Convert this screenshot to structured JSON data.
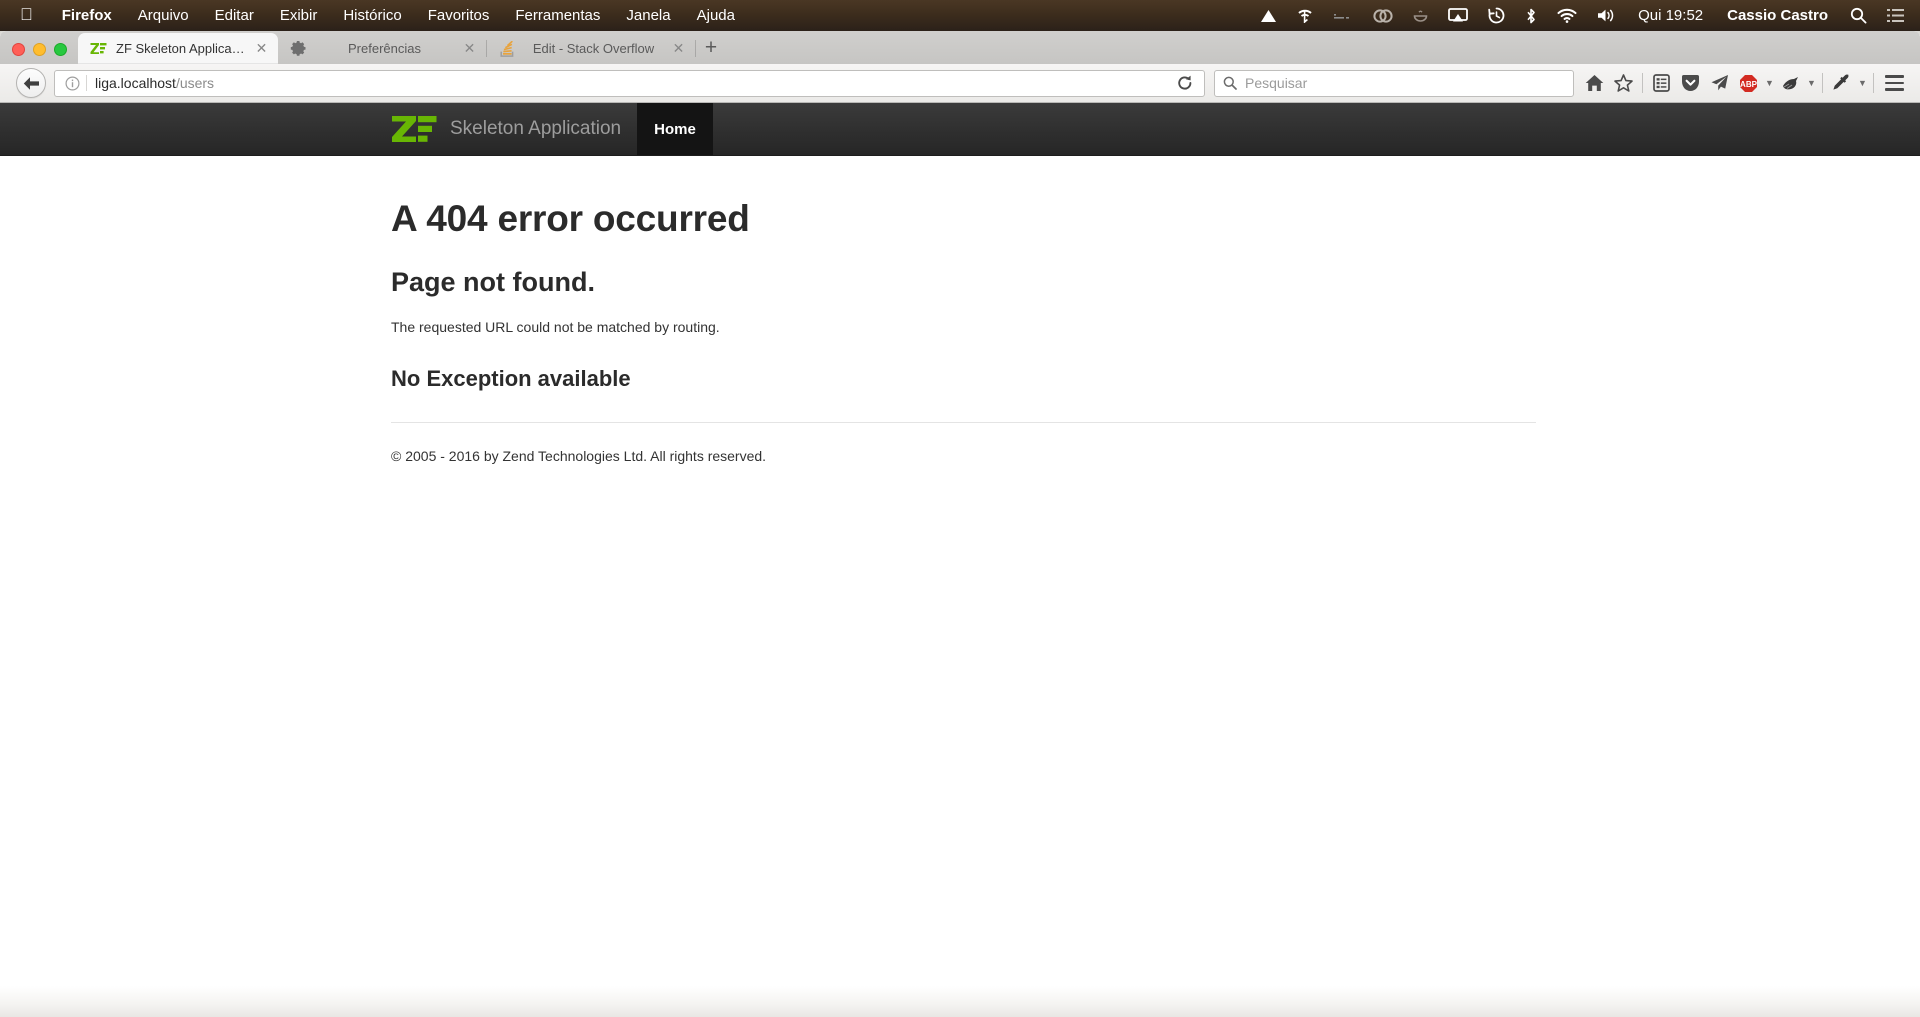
{
  "menubar": {
    "apple_icon": "apple-icon",
    "items": [
      {
        "label": "Firefox",
        "bold": true
      },
      {
        "label": "Arquivo",
        "bold": false
      },
      {
        "label": "Editar",
        "bold": false
      },
      {
        "label": "Exibir",
        "bold": false
      },
      {
        "label": "Histórico",
        "bold": false
      },
      {
        "label": "Favoritos",
        "bold": false
      },
      {
        "label": "Ferramentas",
        "bold": false
      },
      {
        "label": "Janela",
        "bold": false
      },
      {
        "label": "Ajuda",
        "bold": false
      }
    ],
    "status_icons": [
      "triangle-up-icon",
      "wifi-signal-icon",
      "keyboard-icon",
      "creative-cloud-icon",
      "tomato-timer-icon",
      "airplay-icon",
      "time-machine-icon",
      "bluetooth-icon",
      "wifi-icon",
      "volume-icon"
    ],
    "clock": "Qui 19:52",
    "user": "Cassio Castro",
    "search_icon": "search-icon",
    "notification_icon": "notification-center-icon"
  },
  "window": {
    "traffic_lights": [
      "close-button",
      "minimize-button",
      "zoom-button"
    ],
    "tabs": [
      {
        "title": "ZF Skeleton Application",
        "favicon": "zf-favicon",
        "active": true,
        "close_label": "✕"
      },
      {
        "title": "Preferências",
        "favicon": "gear-icon",
        "active": false,
        "close_label": "✕"
      },
      {
        "title": "Edit - Stack Overflow",
        "favicon": "stack-overflow-favicon",
        "active": false,
        "close_label": "✕"
      }
    ],
    "new_tab_label": "+"
  },
  "toolbar": {
    "back_icon": "back-arrow-icon",
    "identity_icon": "info-icon",
    "url_host": "liga.localhost",
    "url_path": "/users",
    "reload_icon": "reload-icon",
    "search": {
      "icon": "search-icon",
      "placeholder": "Pesquisar",
      "value": ""
    },
    "icons": [
      {
        "name": "home-icon",
        "dropdown": false
      },
      {
        "name": "bookmark-star-icon",
        "dropdown": false
      },
      {
        "name": "reading-list-icon",
        "dropdown": false
      },
      {
        "name": "pocket-icon",
        "dropdown": false
      },
      {
        "name": "telegram-send-icon",
        "dropdown": false
      },
      {
        "name": "adblock-plus-icon",
        "label": "ABP",
        "dropdown": true
      },
      {
        "name": "extension-icon",
        "dropdown": true
      },
      {
        "name": "eyedropper-icon",
        "dropdown": true
      }
    ],
    "menu_icon": "hamburger-menu-icon"
  },
  "page": {
    "brand": {
      "logo": "zend-framework-logo",
      "name": "Skeleton Application"
    },
    "nav": [
      {
        "label": "Home",
        "active": true
      }
    ],
    "heading": "A 404 error occurred",
    "subheading": "Page not found.",
    "message": "The requested URL could not be matched by routing.",
    "exception_heading": "No Exception available",
    "footer": "© 2005 - 2016 by Zend Technologies Ltd. All rights reserved."
  },
  "colors": {
    "zf_green": "#68b604",
    "header_dark": "#2f2f2f",
    "nav_active": "#141414",
    "menubar_brown": "#3d2d1d",
    "abp_red": "#d32b22"
  }
}
